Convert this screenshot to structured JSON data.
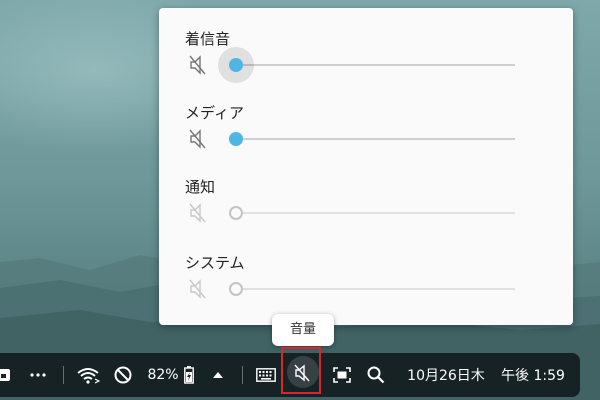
{
  "volume_panel": {
    "ringtone": {
      "label": "着信音",
      "level": 0,
      "muted": true,
      "active": true
    },
    "media": {
      "label": "メディア",
      "level": 0,
      "muted": true,
      "active": true
    },
    "notification": {
      "label": "通知",
      "level": 0,
      "muted": true,
      "active": false
    },
    "system": {
      "label": "システム",
      "level": 0,
      "muted": true,
      "active": false
    }
  },
  "tooltip": {
    "text": "音量"
  },
  "shelf": {
    "battery": "82%",
    "date": "10月26日木",
    "time": "午後 1:59",
    "icons": [
      "launcher-icon",
      "more-icon",
      "wifi-icon",
      "do-not-disturb-icon",
      "battery-icon",
      "up-arrow-icon",
      "keyboard-icon",
      "volume-mute-icon",
      "screenshot-icon",
      "search-icon"
    ]
  },
  "colors": {
    "accent": "#4fb6e3",
    "highlight": "#d9262c",
    "shelf": "#141c20"
  }
}
